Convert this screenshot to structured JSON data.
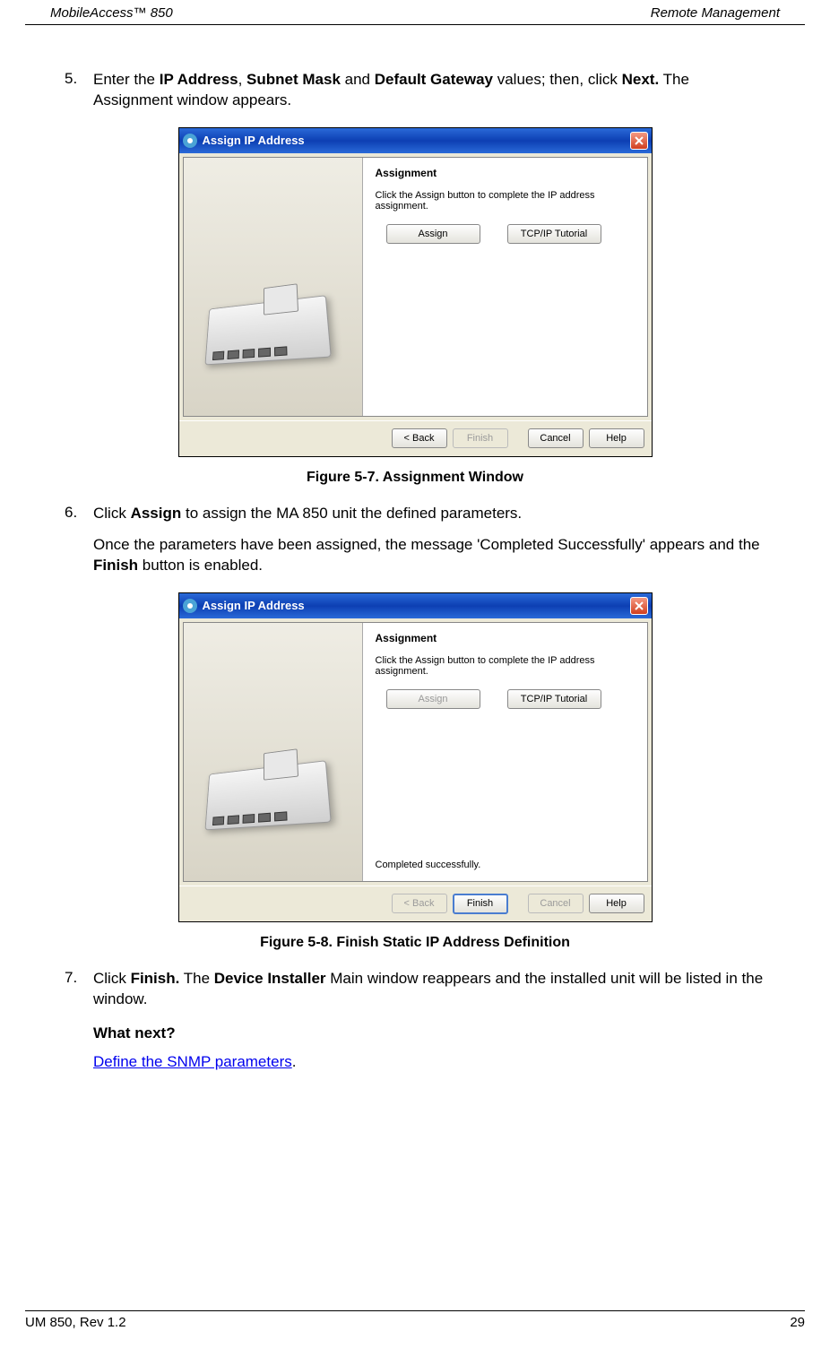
{
  "header": {
    "left": "MobileAccess™  850",
    "right": "Remote Management"
  },
  "step5": {
    "num": "5.",
    "text_before": "Enter the ",
    "bold1": "IP Address",
    "comma1": ", ",
    "bold2": "Subnet Mask",
    "and": " and ",
    "bold3": "Default Gateway",
    "text_mid": " values; then, click ",
    "bold4": "Next.",
    "text_after": " The Assignment window appears."
  },
  "dialog1": {
    "title": "Assign IP Address",
    "heading": "Assignment",
    "desc": "Click the Assign button to complete the IP address assignment.",
    "assign_btn": "Assign",
    "tutorial_btn": "TCP/IP Tutorial",
    "back_btn": "< Back",
    "finish_btn": "Finish",
    "cancel_btn": "Cancel",
    "help_btn": "Help"
  },
  "caption1": "Figure 5-7. Assignment Window",
  "step6": {
    "num": "6.",
    "text_before": " Click ",
    "bold1": "Assign",
    "text_after": " to assign the MA 850 unit the defined parameters."
  },
  "step6_para": {
    "text_before": "Once the parameters have been assigned, the message 'Completed Successfully' appears and the ",
    "bold1": "Finish",
    "text_after": " button is enabled."
  },
  "dialog2": {
    "title": "Assign IP Address",
    "heading": "Assignment",
    "desc": "Click the Assign button to complete the IP address assignment.",
    "assign_btn": "Assign",
    "tutorial_btn": "TCP/IP Tutorial",
    "completed": "Completed successfully.",
    "back_btn": "< Back",
    "finish_btn": "Finish",
    "cancel_btn": "Cancel",
    "help_btn": "Help"
  },
  "caption2": "Figure 5-8. Finish Static IP Address Definition",
  "step7": {
    "num": "7.",
    "text_before": "Click ",
    "bold1": "Finish.",
    "text_mid": " The ",
    "bold2": "Device Installer",
    "text_after": " Main window reappears and the installed unit will be listed in the window."
  },
  "what_next": "What next?",
  "snmp_link": "Define the SNMP parameters",
  "period": ".",
  "footer": {
    "left": "UM 850, Rev 1.2",
    "right": "29"
  }
}
